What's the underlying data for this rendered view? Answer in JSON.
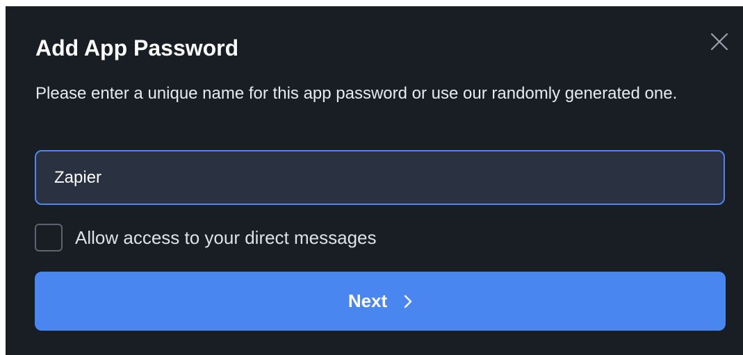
{
  "dialog": {
    "title": "Add App Password",
    "close_icon": "close-icon",
    "description": "Please enter a unique name for this app password or use our randomly generated one.",
    "name_input": {
      "value": "Zapier",
      "placeholder": ""
    },
    "checkbox": {
      "label": "Allow access to your direct messages",
      "checked": false
    },
    "next_button": {
      "label": "Next",
      "icon": "chevron-right-icon"
    }
  },
  "colors": {
    "background": "#181e23",
    "input_background": "#2a3140",
    "accent": "#4a86f0",
    "input_border": "#4f86ee"
  }
}
